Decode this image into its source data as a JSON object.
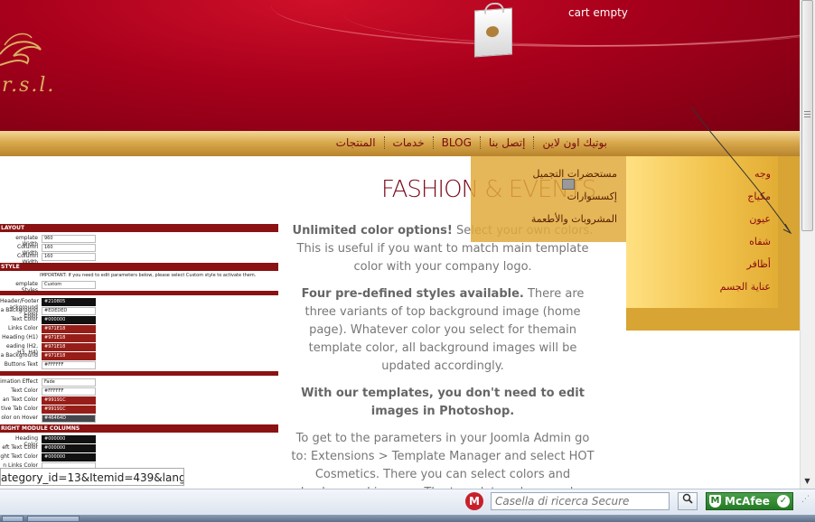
{
  "header": {
    "logo_text": "r.s.l.",
    "cart_text": "cart empty"
  },
  "nav": {
    "items": [
      "بوتيك اون لاين",
      "إتصل بنا",
      "BLOG",
      "خدمات",
      "المنتجات"
    ]
  },
  "submenu_right": {
    "items": [
      "وجه",
      "مكياج",
      "عيون",
      "شفاه",
      "أظافر",
      "عناية الجسم"
    ]
  },
  "submenu_left": {
    "items": [
      "مستحضرات التجميل",
      "إكسسوارات",
      "المشروبات والأطعمة"
    ]
  },
  "main": {
    "title": "FASHION & EVENTS",
    "p1_bold": "Unlimited color options!",
    "p1_text": " Select your own colors. This is useful if you want to match main template color with your company logo.",
    "p2_bold": "Four pre-defined styles available.",
    "p2_text": " There are three variants of top background image (home page). Whatever color you select for themain template color, all background images will be updated accordingly.",
    "p3_bold": "With our templates, you don't need to edit images in Photoshop.",
    "p4_text": "To get to the parameters in your Joomla Admin go to: Extensions > Template Manager and select HOT Cosmetics. There you can select colors and background images. The template colors can be"
  },
  "admin_shot": {
    "sec_layout": "LAYOUT",
    "rows_layout": [
      {
        "label": "emplate Width",
        "value": "960"
      },
      {
        "label": "Column Width",
        "value": "160"
      },
      {
        "label": "Column Width",
        "value": "160"
      }
    ],
    "sec_style": "STYLE",
    "note": "IMPORTANT: If you need to edit parameters below, please select Custom style to activate them.",
    "style_row": {
      "label": "emplate Styles",
      "value": "Custom"
    },
    "rows_colors": [
      {
        "label": "Header/Footer ackground Color",
        "value": "#210805",
        "kind": "dark"
      },
      {
        "label": "a Background Color",
        "value": "#EDEDED",
        "kind": "light"
      },
      {
        "label": "Text Color",
        "value": "#000000",
        "kind": "dark"
      },
      {
        "label": "Links Color",
        "value": "#971E18",
        "kind": "red"
      },
      {
        "label": "Heading (H1)",
        "value": "#971E18",
        "kind": "red"
      },
      {
        "label": "eading (H2, H3, H4)",
        "value": "#971E18",
        "kind": "red"
      },
      {
        "label": "a Background",
        "value": "#971E18",
        "kind": "red"
      },
      {
        "label": "Buttons Text",
        "value": "#FFFFFF",
        "kind": "light"
      }
    ],
    "rows_menu": [
      {
        "label": "imation Effect",
        "value": "Fade",
        "kind": "light"
      },
      {
        "label": "Text Color",
        "value": "#FFFFFF",
        "kind": "light"
      },
      {
        "label": "an Text Color",
        "value": "#99191C",
        "kind": "red"
      },
      {
        "label": "tive Tab Color",
        "value": "#99191C",
        "kind": "red"
      },
      {
        "label": "olor on Hover",
        "value": "#46464D",
        "kind": "grey"
      }
    ],
    "sec_right": "RIGHT MODULE COLUMNS",
    "rows_right": [
      {
        "label": "Heading Color",
        "value": "#000000",
        "kind": "dark"
      },
      {
        "label": "eft Text Color",
        "value": "#000000",
        "kind": "dark"
      },
      {
        "label": "ght Text Color",
        "value": "#000000",
        "kind": "dark"
      },
      {
        "label": "n Links Color",
        "value": "",
        "kind": "light"
      }
    ]
  },
  "status": {
    "url": "ategory_id=13&Itemid=439&lang=aa"
  },
  "toolbar": {
    "search_placeholder": "Casella di ricerca Secure",
    "mcafee_label": "McAfee",
    "mcafee_mark": "M",
    "ok_mark": "✓"
  },
  "colors": {
    "brand_red": "#a8001c",
    "gold": "#d9a94c",
    "link_red": "#971E18"
  }
}
